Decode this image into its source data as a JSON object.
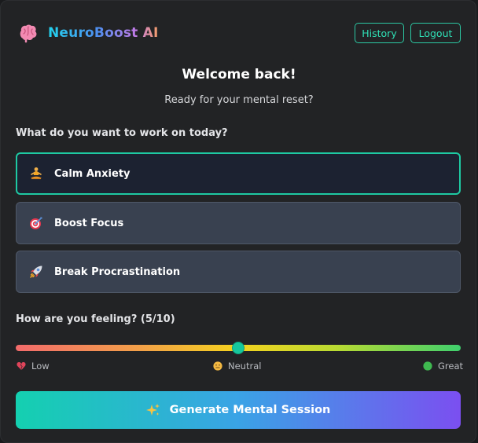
{
  "header": {
    "app_name": "NeuroBoost AI",
    "logo_icon": "brain-icon",
    "history_label": "History",
    "logout_label": "Logout"
  },
  "welcome": {
    "title": "Welcome back!",
    "subtitle": "Ready for your mental reset?"
  },
  "goals": {
    "question": "What do you want to work on today?",
    "options": [
      {
        "label": "Calm Anxiety",
        "icon": "meditation-icon",
        "selected": true
      },
      {
        "label": "Boost Focus",
        "icon": "target-icon",
        "selected": false
      },
      {
        "label": "Break Procrastination",
        "icon": "rocket-icon",
        "selected": false
      }
    ]
  },
  "feeling": {
    "label": "How are you feeling? (5/10)",
    "value": 5,
    "min": 0,
    "max": 10,
    "scale": {
      "low": {
        "label": "Low",
        "icon": "broken-heart-icon"
      },
      "neutral": {
        "label": "Neutral",
        "icon": "neutral-face-icon"
      },
      "great": {
        "label": "Great",
        "icon": "green-circle-icon"
      }
    }
  },
  "cta": {
    "label": "Generate Mental Session",
    "icon": "sparkles-icon"
  },
  "colors": {
    "accent": "#1ec9a2",
    "card_bg": "#222325",
    "option_bg": "#394150",
    "selected_bg": "#1c2231"
  }
}
